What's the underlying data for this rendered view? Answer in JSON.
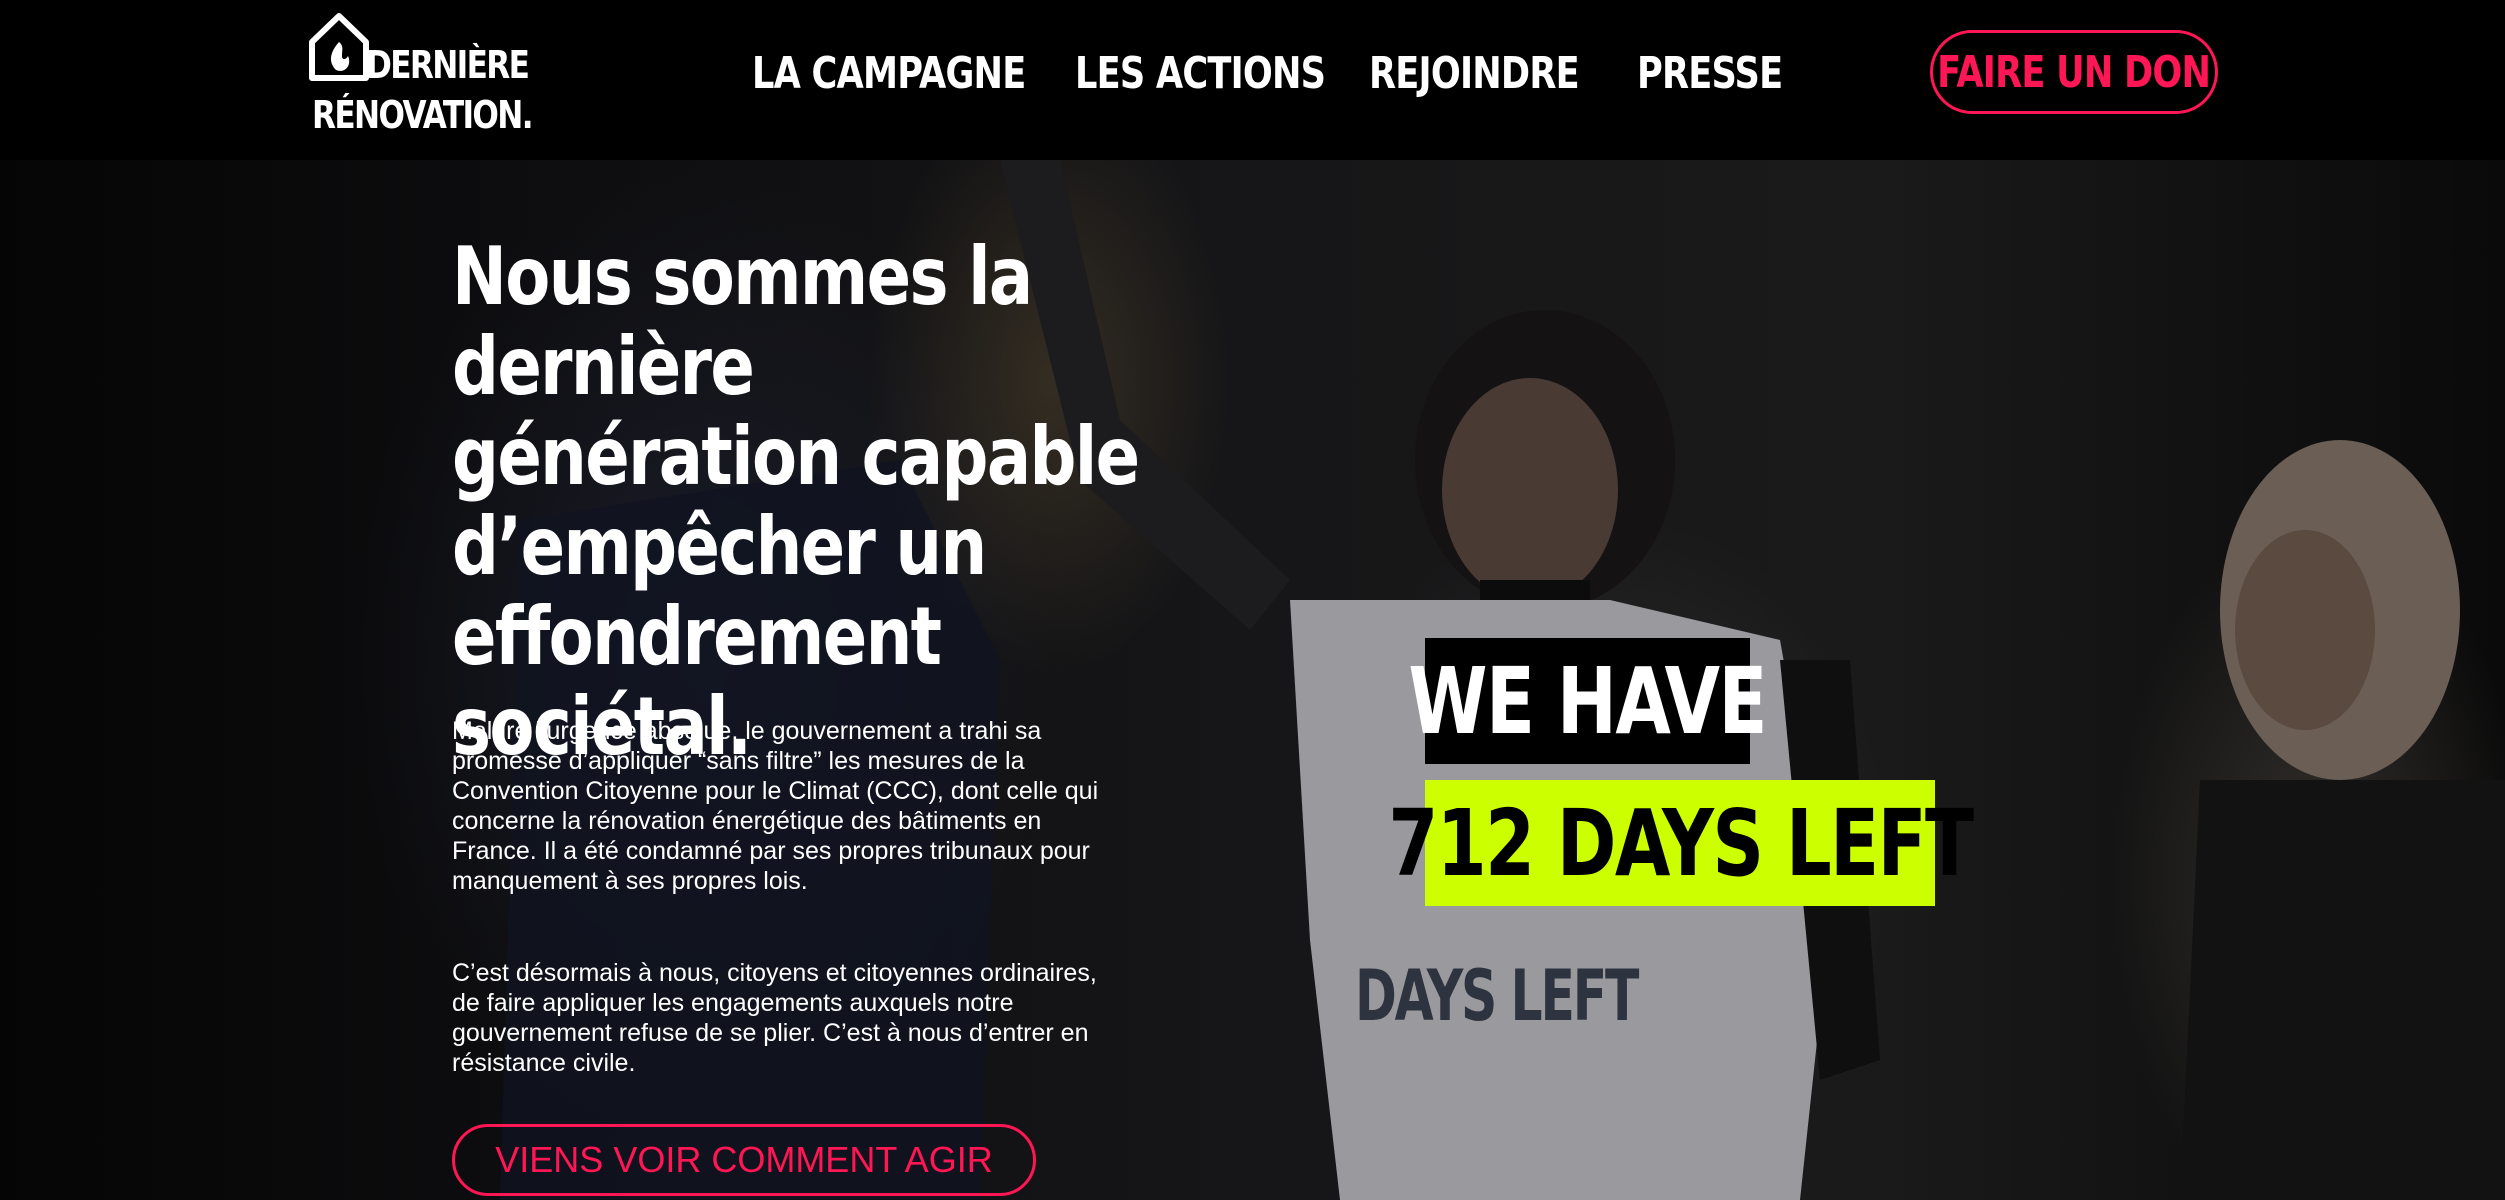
{
  "brand": {
    "logo_line1": "DERNIÈRE",
    "logo_line2": "RÉNOVATION."
  },
  "nav": {
    "items": [
      {
        "label": "LA CAMPAGNE"
      },
      {
        "label": "LES ACTIONS"
      },
      {
        "label": "REJOINDRE"
      },
      {
        "label": "PRESSE"
      }
    ],
    "donate_label": "FAIRE UN DON"
  },
  "hero": {
    "headline": "Nous sommes la dernière génération capable d’empêcher un effondrement sociétal.",
    "paragraph1": "Malgré l’urgence absolue, le gouvernement a trahi sa promesse d’appliquer “sans filtre” les mesures de la Convention Citoyenne pour le Climat (CCC), dont celle qui concerne la rénovation énergétique des bâtiments en France. Il a été condamné par ses propres tribunaux pour manquement à ses propres lois.",
    "paragraph2": "C’est désormais à nous, citoyens et citoyennes ordinaires, de faire appliquer les engagements auxquels notre gouvernement refuse de se plier. C’est à nous d’entrer en résistance civile.",
    "cta_label": "VIENS VOIR COMMENT AGIR",
    "tag_top": "WE HAVE",
    "tag_bottom": "712 DAYS LEFT",
    "shirt_text_line1": "DAYS LEFT"
  },
  "colors": {
    "accent": "#ff1654",
    "highlight": "#ccff00",
    "background": "#000000"
  }
}
